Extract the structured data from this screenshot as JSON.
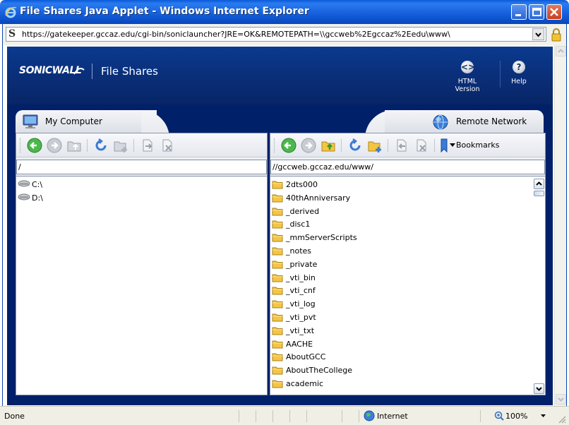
{
  "window": {
    "title": "File Shares Java Applet - Windows Internet Explorer",
    "url": "https://gatekeeper.gccaz.edu/cgi-bin/soniclauncher?JRE=OK&REMOTEPATH=\\\\gccweb%2Egccaz%2Eedu\\www\\",
    "address_icon": "S"
  },
  "applet": {
    "logo": "SONICWALL",
    "title": "File Shares",
    "html_version_label": "HTML Version",
    "help_label": "Help",
    "html_version_icon": "<>",
    "help_icon": "?"
  },
  "left_pane": {
    "tab_label": "My Computer",
    "path": "/",
    "items": [
      {
        "name": "C:\\",
        "icon": "drive-icon"
      },
      {
        "name": "D:\\",
        "icon": "drive-icon"
      }
    ]
  },
  "right_pane": {
    "tab_label": "Remote Network",
    "path": "//gccweb.gccaz.edu/www/",
    "bookmarks_label": "Bookmarks",
    "items": [
      {
        "name": "2dts000",
        "icon": "folder-icon"
      },
      {
        "name": "40thAnniversary",
        "icon": "folder-icon"
      },
      {
        "name": "_derived",
        "icon": "folder-icon"
      },
      {
        "name": "_disc1",
        "icon": "folder-icon"
      },
      {
        "name": "_mmServerScripts",
        "icon": "folder-icon"
      },
      {
        "name": "_notes",
        "icon": "folder-icon"
      },
      {
        "name": "_private",
        "icon": "folder-icon"
      },
      {
        "name": "_vti_bin",
        "icon": "folder-icon"
      },
      {
        "name": "_vti_cnf",
        "icon": "folder-icon"
      },
      {
        "name": "_vti_log",
        "icon": "folder-icon"
      },
      {
        "name": "_vti_pvt",
        "icon": "folder-icon"
      },
      {
        "name": "_vti_txt",
        "icon": "folder-icon"
      },
      {
        "name": "AACHE",
        "icon": "folder-icon"
      },
      {
        "name": "AboutGCC",
        "icon": "folder-icon"
      },
      {
        "name": "AboutTheCollege",
        "icon": "folder-icon"
      },
      {
        "name": "academic",
        "icon": "folder-icon"
      }
    ]
  },
  "statusbar": {
    "status": "Done",
    "zone": "Internet",
    "zoom": "100%"
  },
  "colors": {
    "titlebar": "#0a4fc9",
    "applet_bg": "#00206a",
    "folder": "#f5c542"
  }
}
